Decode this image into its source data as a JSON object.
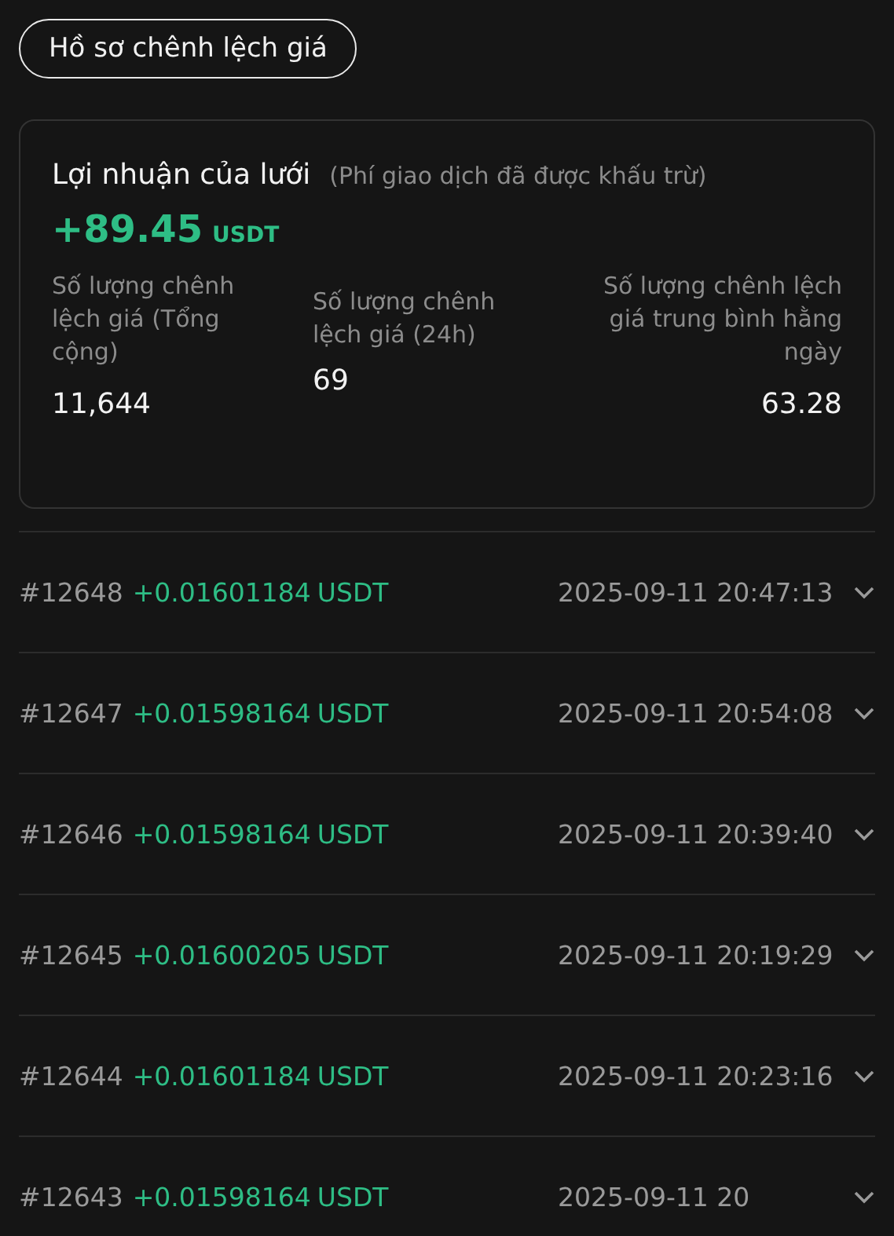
{
  "history_button": "Hồ sơ chênh lệch giá",
  "summary": {
    "title": "Lợi nhuận của lưới",
    "note": "(Phí giao dịch đã được khấu trừ)",
    "profit": "+89.45",
    "currency": "USDT",
    "stats": [
      {
        "label": "Số lượng chênh lệch giá (Tổng cộng)",
        "value": "11,644"
      },
      {
        "label": "Số lượng chênh lệch giá (24h)",
        "value": "69"
      },
      {
        "label": "Số lượng chênh lệch giá trung bình hằng ngày",
        "value": "63.28"
      }
    ]
  },
  "records": [
    {
      "id": "#12648",
      "amount": "+0.01601184",
      "currency": "USDT",
      "time": "2025-09-11 20:47:13",
      "expanded": false
    },
    {
      "id": "#12647",
      "amount": "+0.01598164",
      "currency": "USDT",
      "time": "2025-09-11 20:54:08",
      "expanded": false
    },
    {
      "id": "#12646",
      "amount": "+0.01598164",
      "currency": "USDT",
      "time": "2025-09-11 20:39:40",
      "expanded": false
    },
    {
      "id": "#12645",
      "amount": "+0.01600205",
      "currency": "USDT",
      "time": "2025-09-11 20:19:29",
      "expanded": false
    },
    {
      "id": "#12644",
      "amount": "+0.01601184",
      "currency": "USDT",
      "time": "2025-09-11 20:23:16",
      "expanded": false
    },
    {
      "id": "#12643",
      "amount": "+0.01598164",
      "currency": "USDT",
      "time": "2025-09-11 20",
      "expanded": false
    }
  ]
}
